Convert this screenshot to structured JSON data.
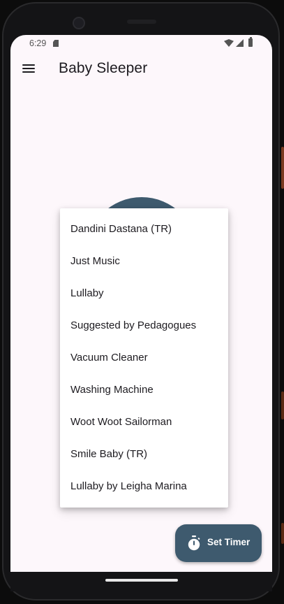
{
  "status_bar": {
    "time": "6:29",
    "icons": [
      "sd-card-icon",
      "wifi-icon",
      "signal-icon",
      "battery-icon"
    ]
  },
  "app_bar": {
    "title": "Baby Sleeper",
    "menu_icon": "menu-icon"
  },
  "sound_menu": {
    "items": [
      {
        "label": "Dandini Dastana (TR)"
      },
      {
        "label": "Just Music"
      },
      {
        "label": "Lullaby"
      },
      {
        "label": "Suggested by Pedagogues"
      },
      {
        "label": "Vacuum Cleaner"
      },
      {
        "label": "Washing Machine"
      },
      {
        "label": "Woot Woot Sailorman"
      },
      {
        "label": "Smile Baby (TR)"
      },
      {
        "label": "Lullaby by Leigha Marina"
      }
    ]
  },
  "fab": {
    "label": "Set Timer",
    "icon": "timer-icon"
  },
  "colors": {
    "accent": "#3e5a6e",
    "background": "#fdf7fb",
    "menu_surface": "#ffffff",
    "text": "#1d1b20"
  }
}
